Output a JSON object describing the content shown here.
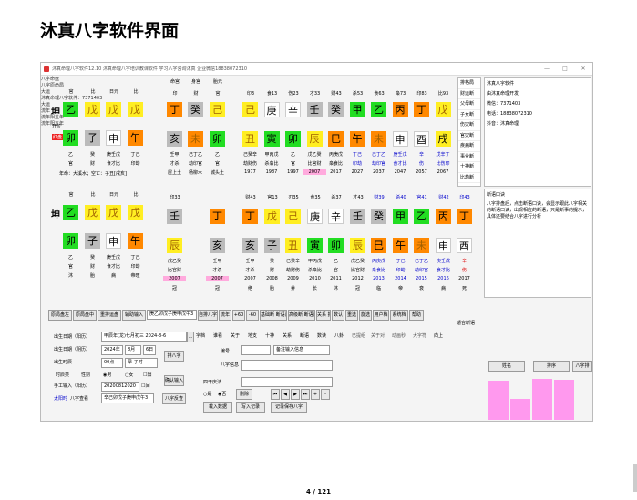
{
  "doc": {
    "title": "沐真八字软件界面",
    "page": "4 / 121"
  },
  "window": {
    "title": "沐真命理八字软件12.10 沐真命理八字培训教课软件 学习八字咨询沐真 企业微信18838072310"
  },
  "chart1": {
    "title": "八字命盘",
    "labels": {
      "qiankun": "坤",
      "open": "开位",
      "red": "红盘",
      "nayin": "年命：大溪水；空亡：子丑[戌亥]"
    },
    "pillars": [
      {
        "top": "官",
        "stem": "乙",
        "branch": "卯",
        "h1": "乙",
        "h2": "官",
        "h3": "沐"
      },
      {
        "top": "比",
        "stem": "戊",
        "branch": "子",
        "h1": "癸",
        "h2": "财",
        "h3": "胎"
      },
      {
        "top": "日元",
        "stem": "戊",
        "branch": "申",
        "h1": "庚壬戊",
        "h2": "食才比",
        "h3": "病"
      },
      {
        "top": "比",
        "stem": "戊",
        "branch": "午",
        "h1": "丁己",
        "h2": "印劫",
        "h3": "帝旺"
      }
    ]
  },
  "chart2": {
    "title": "八字原命局",
    "labels": {
      "qiankun": "坤"
    },
    "pillars": [
      {
        "top": "官",
        "stem": "乙",
        "branch": "卯",
        "h1": "乙",
        "h2": "官",
        "h3": "沐"
      },
      {
        "top": "比",
        "stem": "戊",
        "branch": "子",
        "h1": "癸",
        "h2": "财",
        "h3": "胎"
      },
      {
        "top": "日元",
        "stem": "戊",
        "branch": "申",
        "h1": "庚壬戊",
        "h2": "食才比",
        "h3": "病"
      },
      {
        "top": "比",
        "stem": "戊",
        "branch": "午",
        "h1": "丁己",
        "h2": "印劫",
        "h3": "帝旺"
      }
    ]
  },
  "tiangan": {
    "header": [
      "命宫",
      "身宫",
      "胎元"
    ],
    "tops": [
      "印",
      "财",
      "官"
    ],
    "stems": [
      "丁",
      "癸",
      "己"
    ],
    "branches": [
      "亥",
      "未",
      "卯"
    ],
    "h1": [
      "壬甲",
      "己丁乙",
      "乙"
    ],
    "h2": [
      "才杀",
      "劫印官",
      "官"
    ],
    "h3": [
      "屋上土",
      "杨柳木",
      "城头土"
    ]
  },
  "dayun": {
    "title": "大运",
    "header": "沐真命理八字软件：7371403",
    "tops": [
      "印3",
      "食13",
      "伤23",
      "才33",
      "财43",
      "杀53",
      "食63",
      "枭73",
      "印83",
      "比93"
    ],
    "stems": [
      "己",
      "庚",
      "辛",
      "壬",
      "癸",
      "甲",
      "乙",
      "丙",
      "丁",
      "戊"
    ],
    "branches": [
      "丑",
      "寅",
      "卯",
      "辰",
      "巳",
      "午",
      "未",
      "申",
      "酉",
      "戌"
    ],
    "h1": [
      "己癸辛",
      "甲丙戊",
      "乙",
      "戊乙癸",
      "丙庚戊",
      "丁己",
      "己丁乙",
      "庚壬戊",
      "辛",
      "戊辛丁"
    ],
    "h2": [
      "劫财伤",
      "杀枭比",
      "官",
      "比官财",
      "枭食比",
      "印劫",
      "劫印官",
      "食才比",
      "伤",
      "比伤印"
    ],
    "years": [
      "1977",
      "1987",
      "1997",
      "2007",
      "2017",
      "2027",
      "2037",
      "2047",
      "2057",
      "2067"
    ]
  },
  "bottom_luck": {
    "titles": [
      "大运",
      "流年",
      "流年阳五年",
      "流年阳五年"
    ],
    "tops": [
      "才33",
      "印33",
      "",
      "财43",
      "官13",
      "刃35",
      "食35",
      "杀37",
      "才43",
      "财39",
      "杀40",
      "官41",
      "财42",
      "印43"
    ],
    "stems": [
      "壬",
      "丁",
      "丁",
      "戊",
      "己",
      "庚",
      "辛",
      "壬",
      "癸",
      "甲",
      "乙",
      "丙",
      "丁"
    ],
    "branches": [
      "辰",
      "亥",
      "亥",
      "子",
      "丑",
      "寅",
      "卯",
      "辰",
      "巳",
      "午",
      "未",
      "申",
      "酉"
    ],
    "h1": [
      "戊乙癸",
      "壬甲",
      "壬甲",
      "癸",
      "己癸辛",
      "甲丙戊",
      "乙",
      "戊乙癸",
      "丙庚戊",
      "丁己",
      "己丁乙",
      "庚壬戊",
      "辛"
    ],
    "h2": [
      "比官财",
      "才杀",
      "才杀",
      "财",
      "劫财伤",
      "杀枭比",
      "官",
      "比官财",
      "枭食比",
      "印劫",
      "劫印官",
      "食才比",
      "伤"
    ],
    "years": [
      "2007",
      "2007",
      "2007",
      "2008",
      "2009",
      "2010",
      "2011",
      "2012",
      "2013",
      "2014",
      "2015",
      "2016",
      "2017"
    ],
    "h3": [
      "冠",
      "冠",
      "绝",
      "胎",
      "养",
      "长",
      "沐",
      "冠",
      "临",
      "帝",
      "衰",
      "病",
      "死"
    ]
  },
  "sidebar": {
    "items": [
      "排格局",
      "财运断",
      "父母断",
      "子女断",
      "伤灾断",
      "官灾断",
      "疾病断",
      "事业断",
      "十神断",
      "比劫断"
    ]
  },
  "info": {
    "lines": [
      "沐真八字软件",
      "由沐真命理开发",
      "微信：7371403",
      "电话：18838072310",
      "抖音：沐真命理"
    ]
  },
  "duanyu": {
    "title": "断语口诀",
    "text": "八字排盘后，点击断语口诀，会显示跟此八字相关的断语口诀，出现相应的断语，只是断事的提示，具体还要结合八字进行分析"
  },
  "toolbar": {
    "buttons": [
      "原局盘左",
      "原局盘中",
      "重排运盘",
      "辅助输入",
      "",
      "自排八字",
      "流年",
      "+60",
      "-60",
      "基础断 断语阅",
      "高级断 断语阅",
      "关系 报告",
      "数认",
      "重选",
      "旋选",
      "用户档",
      "系统档",
      "帮助",
      "适合断语"
    ]
  },
  "tabs": {
    "items": [
      "字档",
      "谁看",
      "关于",
      "地支",
      "十神",
      "关系",
      "断语",
      "数读",
      "八卦",
      "已提组",
      "关于对",
      "动画秒",
      "大字符",
      "向上"
    ]
  },
  "form": {
    "labels": {
      "birth_solar": "出生日期（阳历）",
      "birth_lunar": "出生日期（阴历）",
      "hour": "出生时辰",
      "time_type": "时辰类",
      "gender": "性别",
      "manual": "手工输入（阳历）",
      "taiyang": "太阳时",
      "bazi": "八字查看"
    },
    "values": {
      "solar": "甲辰年(龙)七月初三 2024-8-6",
      "year": "2024年",
      "month": "8月",
      "day": "6日",
      "hour": "00点",
      "hour2": "早 子时",
      "male": "男",
      "female": "女",
      "yang": "阳",
      "manual": "20200812020",
      "check": "闰",
      "bazi": "辛己卯戊子庚申戊午3"
    },
    "buttons": {
      "pai": "排八字",
      "confirm": "确认输入",
      "bazi_btn": "八字反查",
      "top_inp": "庚乙卯戊子庚申戊午3"
    }
  },
  "editor": {
    "labels": {
      "bianhao": "编号",
      "bazi": "八字信息",
      "sizhu": "四干庆法",
      "yes": "是",
      "no": "否",
      "del": "删除"
    },
    "values": {
      "remark": "备注输入信息"
    },
    "buttons": {
      "load": "载入数据",
      "write": "写入记录",
      "save": "记录保存八字"
    }
  },
  "rank": {
    "buttons": [
      "姓名",
      "排序",
      "八字排"
    ],
    "bars": [
      0.85,
      0.45,
      0.9,
      0.88
    ]
  },
  "colors": {
    "wood": "#22dd22",
    "earth": "#ffee22",
    "fire": "#ff8800",
    "metal": "#ffffff",
    "water": "#bbbbbb",
    "pink": "#ffaadd",
    "red": "#ee2222"
  }
}
